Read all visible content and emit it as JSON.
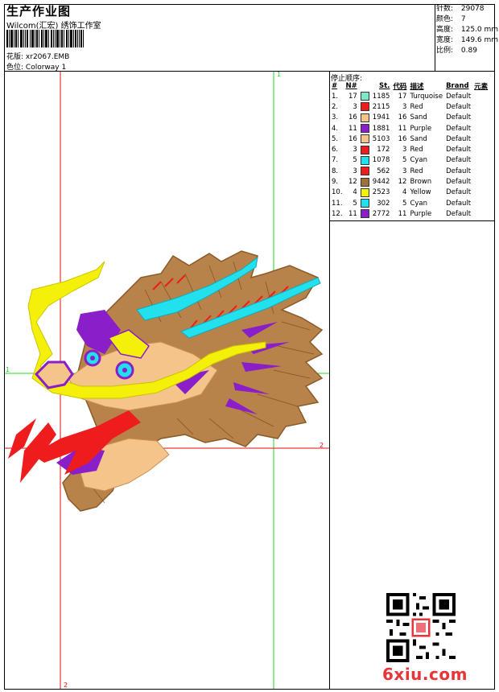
{
  "header": {
    "title": "生产作业图",
    "subtitle": "Wilcom(汇宏) 绣饰工作室",
    "design_label": "花版:",
    "design_value": "xr2067.EMB",
    "colorway_label": "色位:",
    "colorway_value": "Colorway 1"
  },
  "stats": [
    {
      "label": "针数:",
      "value": "29078"
    },
    {
      "label": "颜色:",
      "value": "7"
    },
    {
      "label": "高度:",
      "value": "125.0 mm"
    },
    {
      "label": "宽度:",
      "value": "149.6 mm"
    },
    {
      "label": "比例:",
      "value": "0.89"
    }
  ],
  "stop_sequence": {
    "title": "停止顺序:",
    "headers": [
      "#",
      "N#",
      "St.",
      "代码",
      "描述",
      "Brand",
      "元素"
    ],
    "rows": [
      {
        "idx": "1.",
        "n": "17",
        "color": "#7ee8c8",
        "st": "1185",
        "code": "17",
        "desc": "Turquoise",
        "brand": "Default"
      },
      {
        "idx": "2.",
        "n": "3",
        "color": "#ee1c1c",
        "st": "2115",
        "code": "3",
        "desc": "Red",
        "brand": "Default"
      },
      {
        "idx": "3.",
        "n": "16",
        "color": "#f5c48a",
        "st": "1941",
        "code": "16",
        "desc": "Sand",
        "brand": "Default"
      },
      {
        "idx": "4.",
        "n": "11",
        "color": "#8a1ec8",
        "st": "1881",
        "code": "11",
        "desc": "Purple",
        "brand": "Default"
      },
      {
        "idx": "5.",
        "n": "16",
        "color": "#f5c48a",
        "st": "5103",
        "code": "16",
        "desc": "Sand",
        "brand": "Default"
      },
      {
        "idx": "6.",
        "n": "3",
        "color": "#ee1c1c",
        "st": "172",
        "code": "3",
        "desc": "Red",
        "brand": "Default"
      },
      {
        "idx": "7.",
        "n": "5",
        "color": "#22e0ee",
        "st": "1078",
        "code": "5",
        "desc": "Cyan",
        "brand": "Default"
      },
      {
        "idx": "8.",
        "n": "3",
        "color": "#ee1c1c",
        "st": "562",
        "code": "3",
        "desc": "Red",
        "brand": "Default"
      },
      {
        "idx": "9.",
        "n": "12",
        "color": "#a0703c",
        "st": "9442",
        "code": "12",
        "desc": "Brown",
        "brand": "Default"
      },
      {
        "idx": "10.",
        "n": "4",
        "color": "#f5f00a",
        "st": "2523",
        "code": "4",
        "desc": "Yellow",
        "brand": "Default"
      },
      {
        "idx": "11.",
        "n": "5",
        "color": "#22e0ee",
        "st": "302",
        "code": "5",
        "desc": "Cyan",
        "brand": "Default"
      },
      {
        "idx": "12.",
        "n": "11",
        "color": "#8a1ec8",
        "st": "2772",
        "code": "11",
        "desc": "Purple",
        "brand": "Default"
      }
    ]
  },
  "guides": {
    "top_label": "1",
    "left_label": "1",
    "right_label": "2",
    "bottom_label": "2"
  },
  "colors": {
    "guide_green": "#22d422",
    "guide_red": "#dd1111",
    "watermark": "#e8353a"
  },
  "watermark": {
    "text": "6xiu.com",
    "qr_icon": "qr-code-icon"
  }
}
